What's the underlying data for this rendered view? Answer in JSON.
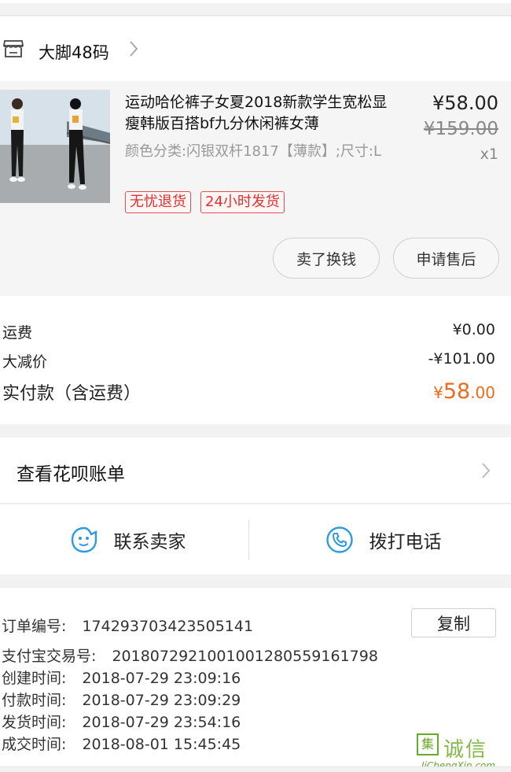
{
  "shop": {
    "name": "大脚48码",
    "icon": "store-icon"
  },
  "product": {
    "title": "运动哈伦裤子女夏2018新款学生宽松显瘦韩版百搭bf九分休闲裤女薄",
    "price": "¥58.00",
    "original_price": "¥159.00",
    "quantity": "x1",
    "spec": "颜色分类:闪银双杆1817【薄款】;尺寸:L",
    "tags": [
      "无忧退货",
      "24小时发货"
    ],
    "actions": {
      "sell_label": "卖了换钱",
      "after_sale_label": "申请售后"
    }
  },
  "costs": {
    "shipping_label": "运费",
    "shipping_value": "¥0.00",
    "discount_label": "大减价",
    "discount_value": "-¥101.00",
    "paid_label": "实付款（含运费）",
    "paid_currency": "¥",
    "paid_int": "58",
    "paid_dec": ".00"
  },
  "huabei": {
    "label": "查看花呗账单"
  },
  "contact": {
    "seller_label": "联系卖家",
    "call_label": "拨打电话"
  },
  "order": {
    "number_label": "订单编号:",
    "number_value": "174293703423505141",
    "copy_label": "复制",
    "alipay_label": "支付宝交易号:",
    "alipay_value": "2018072921001001280559161798",
    "created_label": "创建时间:",
    "created_value": "2018-07-29 23:09:16",
    "paid_label": "付款时间:",
    "paid_value": "2018-07-29 23:09:29",
    "shipped_label": "发货时间:",
    "shipped_value": "2018-07-29 23:54:16",
    "completed_label": "成交时间:",
    "completed_value": "2018-08-01 15:45:45"
  },
  "watermark": {
    "logo": "集",
    "text": "诚信",
    "sub": "JiChengXin.com"
  },
  "colors": {
    "accent": "#ef6a1a",
    "tag_red": "#e0302d",
    "icon_blue": "#2e9be0"
  }
}
